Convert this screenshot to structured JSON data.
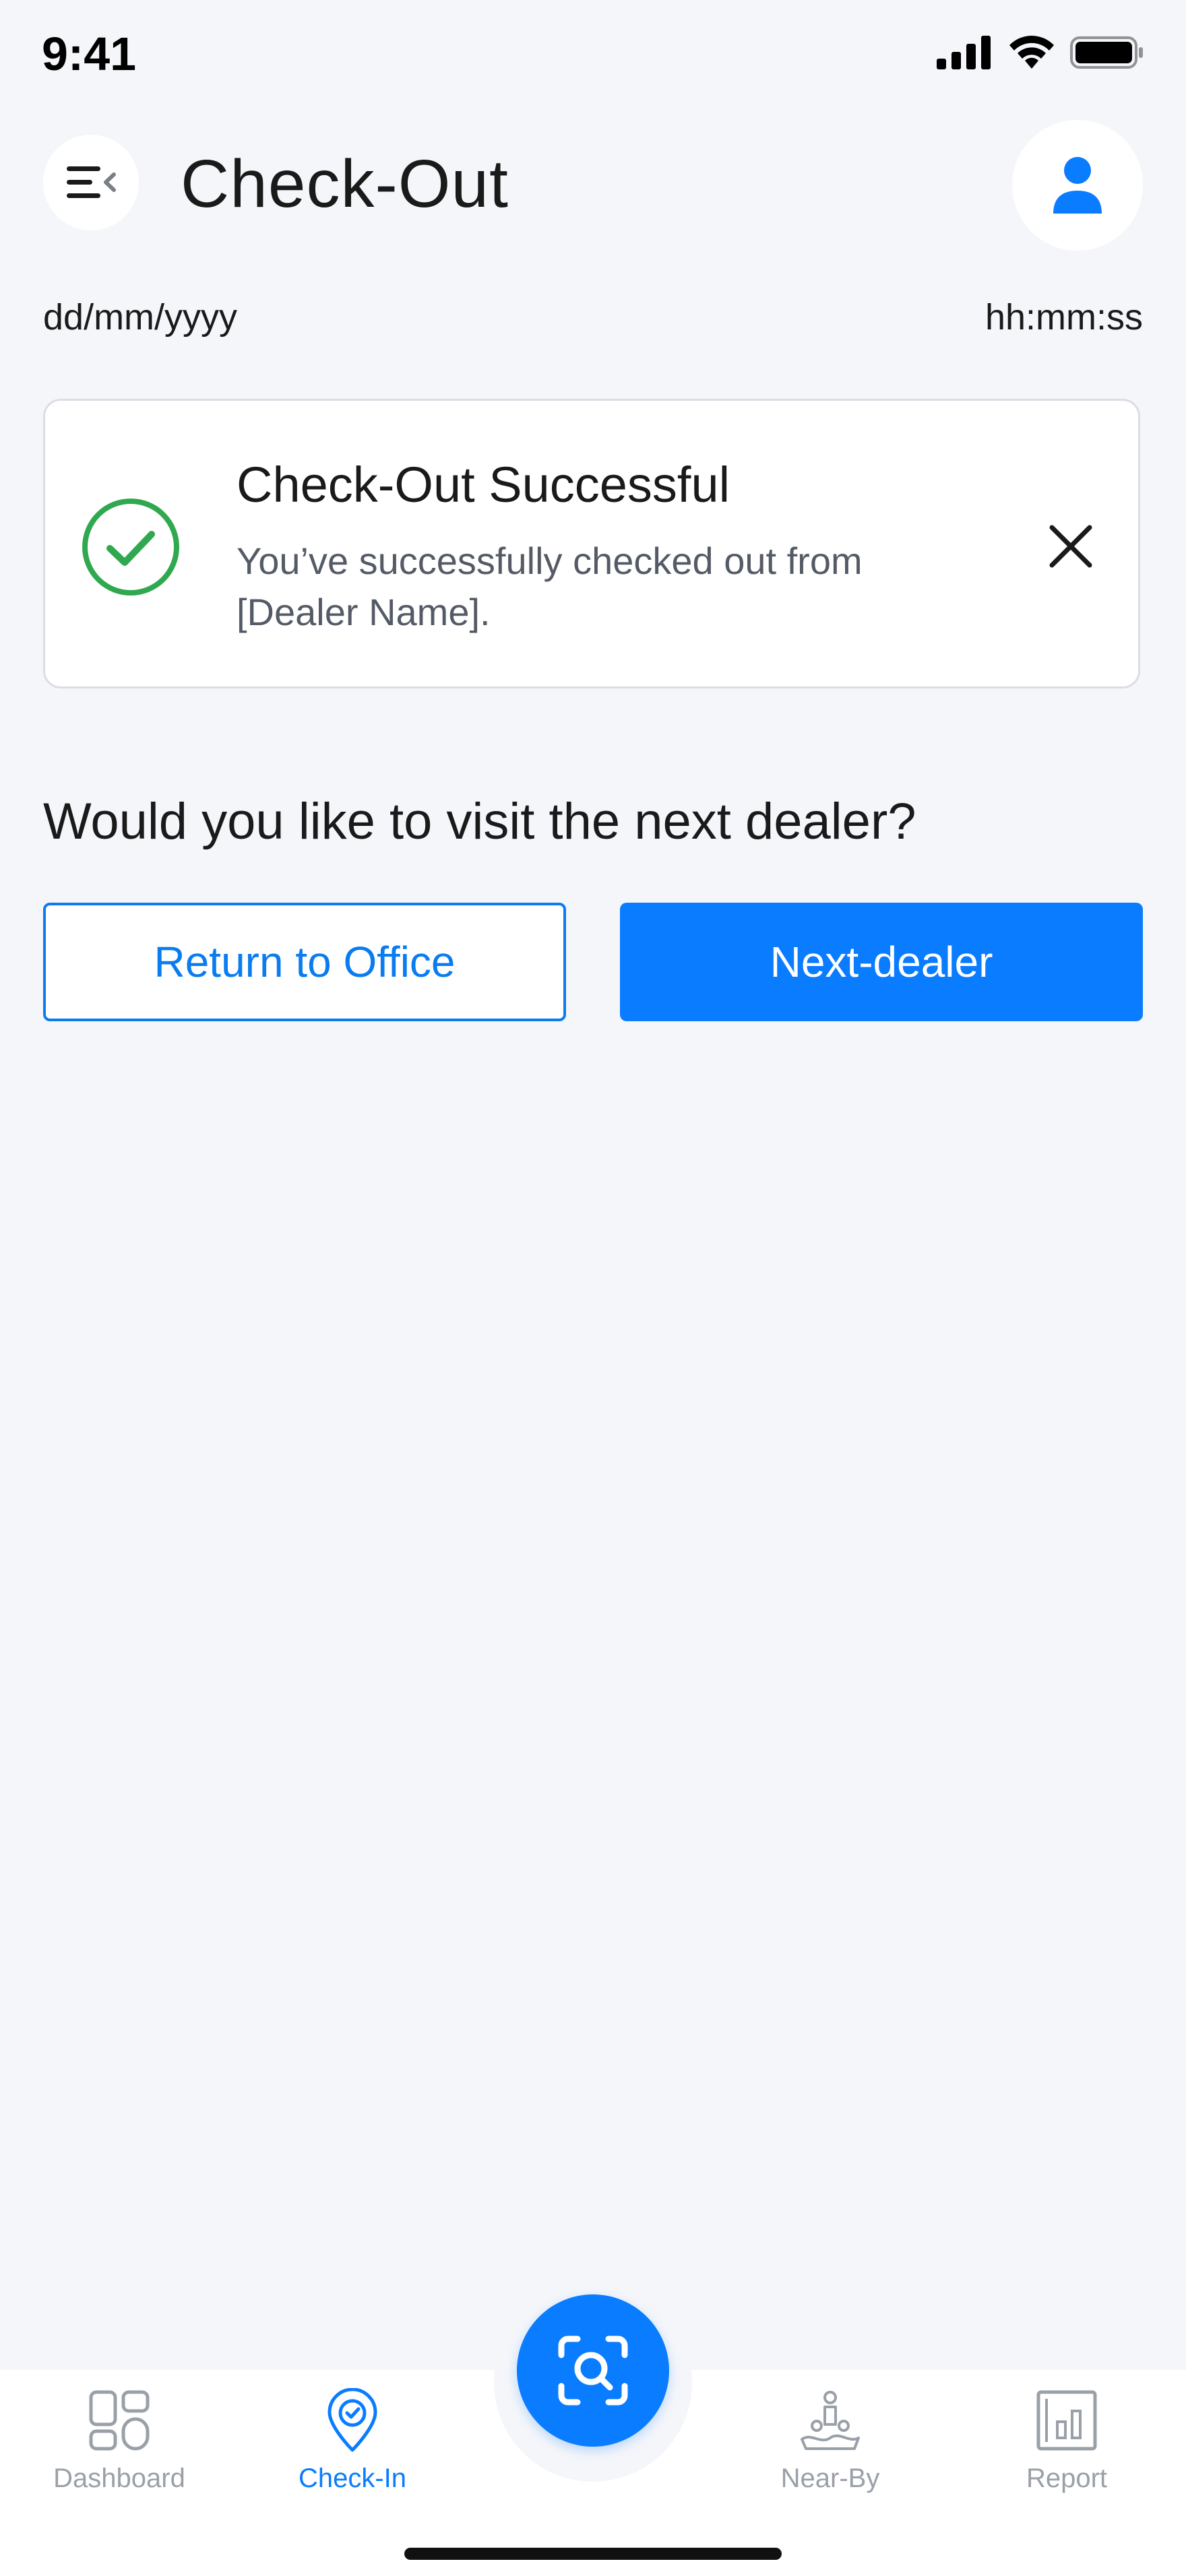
{
  "status": {
    "time": "9:41",
    "icons": [
      "signal-icon",
      "wifi-icon",
      "battery-icon"
    ]
  },
  "header": {
    "title": "Check-Out",
    "menu_icon": "menu-collapse-icon",
    "avatar_icon": "user-icon"
  },
  "datetime": {
    "date": "dd/mm/yyyy",
    "time": "hh:mm:ss"
  },
  "alert": {
    "title": "Check-Out Successful",
    "message": "You’ve successfully checked out from [Dealer Name].",
    "icon": "check-circle-icon",
    "close_icon": "close-icon"
  },
  "prompt": {
    "question": "Would you like to visit the next dealer?",
    "secondary_label": "Return to Office",
    "primary_label": "Next-dealer"
  },
  "tabbar": {
    "items": [
      {
        "label": "Dashboard",
        "icon": "dashboard-icon",
        "active": false
      },
      {
        "label": "Check-In",
        "icon": "location-check-icon",
        "active": true
      },
      {
        "label": "Near-By",
        "icon": "nearby-map-icon",
        "active": false
      },
      {
        "label": "Report",
        "icon": "report-icon",
        "active": false
      }
    ],
    "fab_icon": "scan-search-icon"
  },
  "colors": {
    "accent": "#0A7CFF",
    "success": "#2FA84F",
    "background": "#F4F6FA",
    "inactive": "#9AA0A8"
  }
}
